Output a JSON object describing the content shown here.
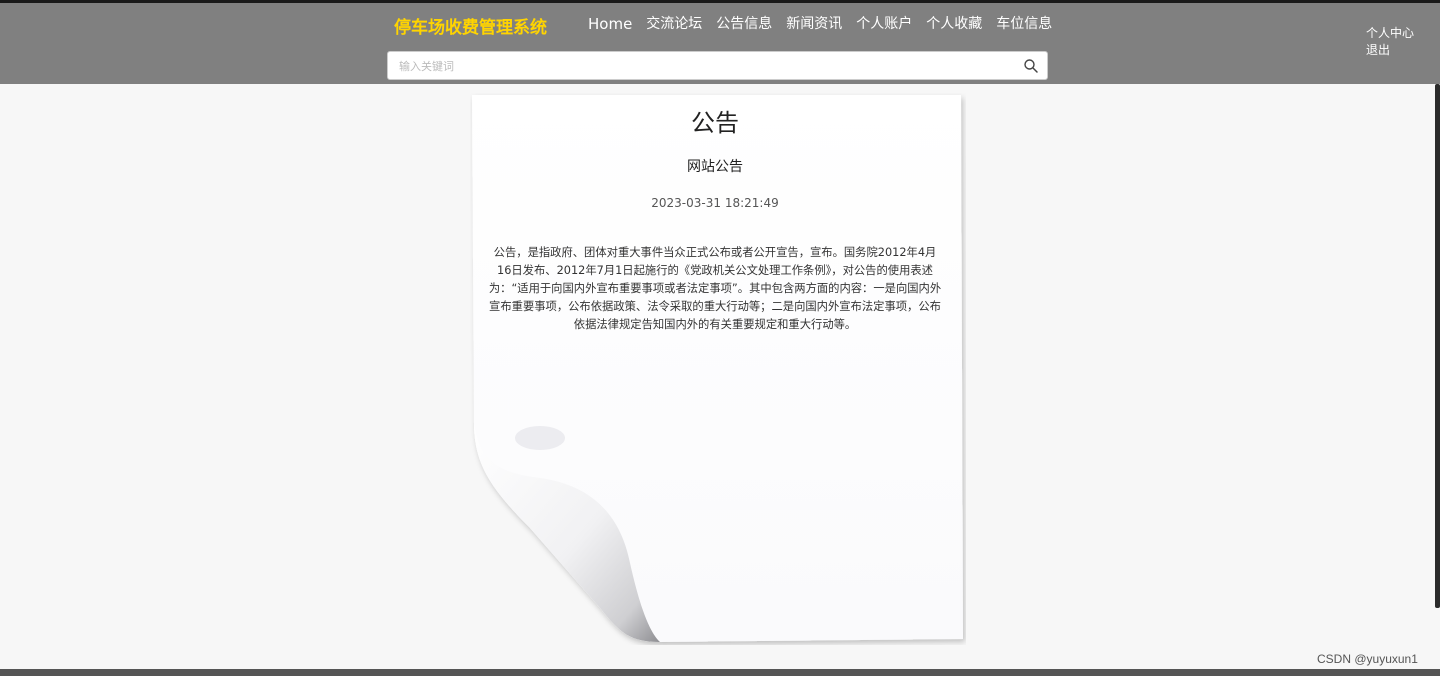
{
  "header": {
    "brand": "停车场收费管理系统",
    "nav": [
      "Home",
      "交流论坛",
      "公告信息",
      "新闻资讯",
      "个人账户",
      "个人收藏",
      "车位信息"
    ],
    "user_center": "个人中心",
    "logout": "退出"
  },
  "search": {
    "placeholder": "输入关键词",
    "value": ""
  },
  "notice": {
    "heading": "公告",
    "title": "网站公告",
    "time": "2023-03-31 18:21:49",
    "body": "公告，是指政府、团体对重大事件当众正式公布或者公开宣告，宣布。国务院2012年4月16日发布、2012年7月1日起施行的《党政机关公文处理工作条例》，对公告的使用表述为：“适用于向国内外宣布重要事项或者法定事项”。其中包含两方面的内容：一是向国内外宣布重要事项，公布依据政策、法令采取的重大行动等；二是向国内外宣布法定事项，公布依据法律规定告知国内外的有关重要规定和重大行动等。"
  },
  "watermark": "CSDN @yuyuxun1",
  "colors": {
    "header_bg": "#808080",
    "brand": "#ffd400",
    "page_bg": "#f7f7f7"
  }
}
